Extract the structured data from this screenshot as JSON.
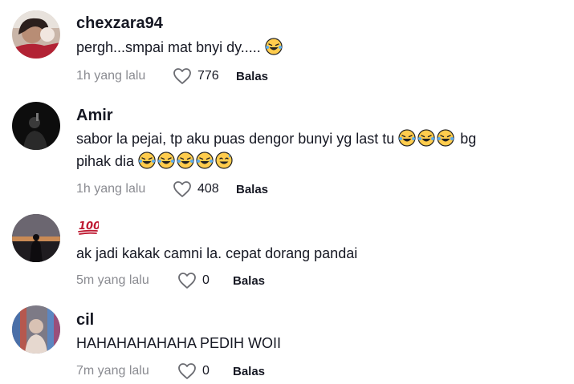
{
  "comments": [
    {
      "username": "chexzara94",
      "text": "pergh...smpai mat bnyi dy.....",
      "time": "1h yang lalu",
      "likes": "776",
      "reply_label": "Balas"
    },
    {
      "username": "Amir",
      "text_line1": "sabor la pejai, tp aku puas dengor bunyi yg last tu",
      "text_line1_tail": "bg",
      "text_line2": "pihak dia",
      "time": "1h yang lalu",
      "likes": "408",
      "reply_label": "Balas"
    },
    {
      "username_icon": "hundred-points-emoji",
      "text": "ak jadi kakak camni la. cepat dorang pandai",
      "time": "5m yang lalu",
      "likes": "0",
      "reply_label": "Balas"
    },
    {
      "username": "cil",
      "text": "HAHAHAHAHAHA PEDIH WOII",
      "time": "7m yang lalu",
      "likes": "0",
      "reply_label": "Balas"
    }
  ],
  "colors": {
    "text": "#161823",
    "muted": "#8a8b91",
    "emoji_face": "#ffcc4d",
    "hundred_red": "#be1931"
  },
  "icons": [
    "heart-outline-icon",
    "laughing-tears-emoji",
    "sweat-smile-emoji",
    "hundred-points-emoji"
  ]
}
